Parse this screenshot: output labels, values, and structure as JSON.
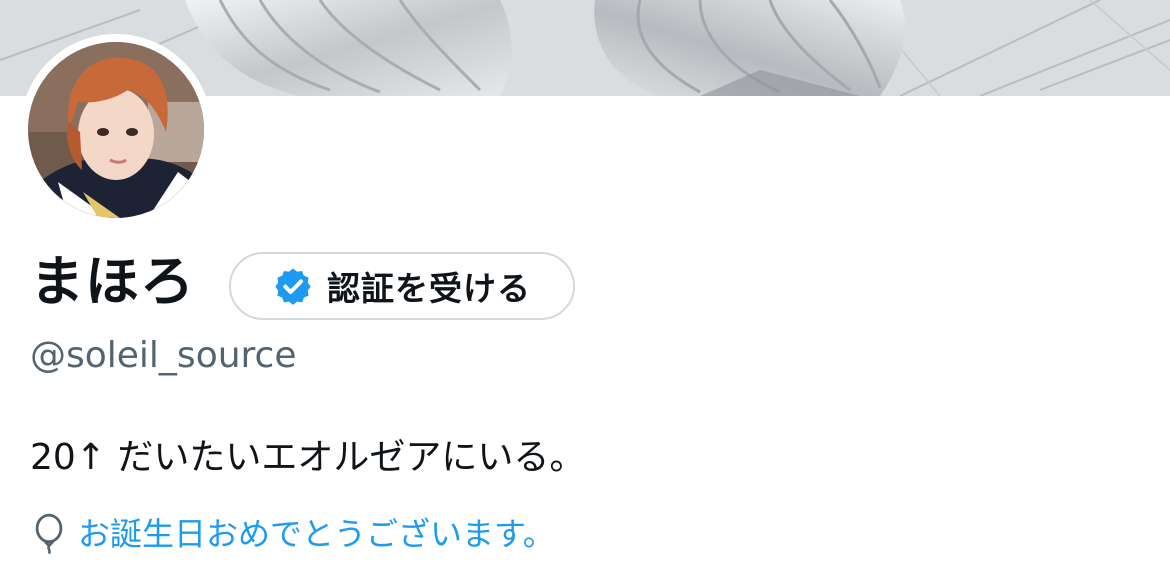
{
  "profile": {
    "display_name": "まほろ",
    "handle": "@soleil_source",
    "bio": "20↑ だいたいエオルゼアにいる。",
    "birthday_text": "お誕生日おめでとうございます。"
  },
  "verify_button": {
    "label": "認証を受ける",
    "icon": "verified-badge-icon"
  },
  "icons": {
    "birthday": "balloon-icon"
  },
  "colors": {
    "accent": "#1d9bf0",
    "verified_badge": "#1d9bf0",
    "text_primary": "#0f1419",
    "text_secondary": "#536471",
    "button_border": "#cfd9de"
  }
}
